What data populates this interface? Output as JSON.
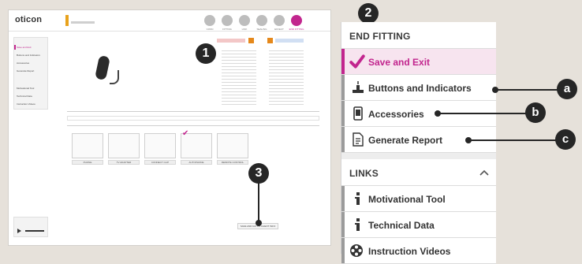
{
  "app": {
    "logo": "oticon",
    "top_steps": [
      "CONN",
      "FITTING",
      "LINK",
      "SEALING",
      "EFFECT",
      "END FITTING"
    ],
    "side_items": [
      "Save and Exit",
      "Buttons and Indicators",
      "Accessories",
      "Generate Report",
      "Motivational Tool",
      "Technical Data",
      "Instruction Videos"
    ],
    "accessories": [
      "PHONE",
      "TV ADAPTER",
      "CONNECT CLIP",
      "AUTOPHONE",
      "REMOTE CONTROL"
    ],
    "bottom_button": "SAVE AND GO TO CLIENT INFO"
  },
  "callouts": {
    "one": "1",
    "two": "2",
    "three": "3",
    "a": "a",
    "b": "b",
    "c": "c"
  },
  "panel": {
    "end_fitting": {
      "title": "END FITTING",
      "items": [
        {
          "label": "Save and Exit",
          "icon": "checkmark-icon",
          "active": true
        },
        {
          "label": "Buttons and Indicators",
          "icon": "buttons-indicators-icon",
          "active": false
        },
        {
          "label": "Accessories",
          "icon": "accessories-phone-icon",
          "active": false
        },
        {
          "label": "Generate Report",
          "icon": "report-document-icon",
          "active": false
        }
      ]
    },
    "links": {
      "title": "LINKS",
      "items": [
        {
          "label": "Motivational Tool",
          "icon": "info-i-icon"
        },
        {
          "label": "Technical Data",
          "icon": "info-i-icon"
        },
        {
          "label": "Instruction Videos",
          "icon": "film-reel-icon"
        }
      ]
    }
  },
  "colors": {
    "accent": "#c2258e",
    "active_bg": "#f7e4ef",
    "badge": "#262626",
    "background": "#e6e1da"
  }
}
